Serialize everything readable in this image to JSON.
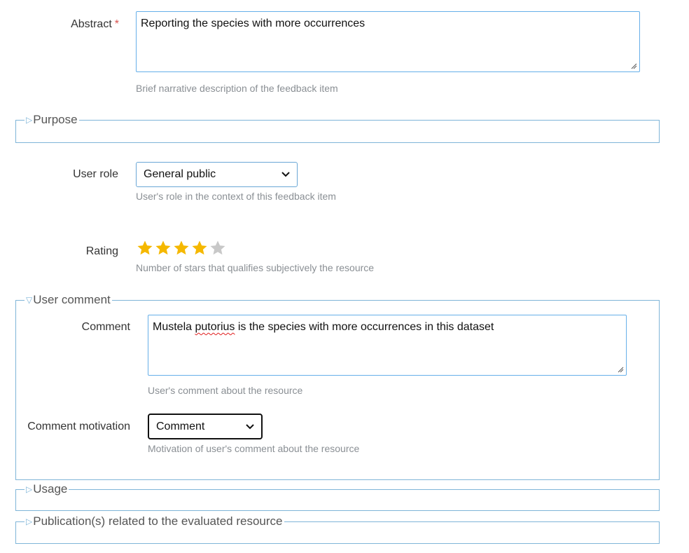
{
  "abstract": {
    "label": "Abstract",
    "required_mark": "*",
    "value": "Reporting the species with more occurrences",
    "help": "Brief narrative description of the feedback item"
  },
  "purpose": {
    "legend": "Purpose",
    "expanded": false
  },
  "user_role": {
    "label": "User role",
    "selected": "General public",
    "help": "User's role in the context of this feedback item"
  },
  "rating": {
    "label": "Rating",
    "value": 4,
    "max": 5,
    "help": "Number of stars that qualifies subjectively the resource",
    "star_color": "#f5b800",
    "empty_color": "#c8c8c8"
  },
  "user_comment": {
    "legend": "User comment",
    "expanded": true,
    "comment": {
      "label": "Comment",
      "value_pre": "Mustela ",
      "value_misspelled": "putorius",
      "value_post": " is the species with more occurrences in this dataset",
      "help": "User's comment about the resource"
    },
    "motivation": {
      "label": "Comment motivation",
      "selected": "Comment",
      "help": "Motivation of user's comment about the resource"
    }
  },
  "usage": {
    "legend": "Usage",
    "expanded": false
  },
  "publications": {
    "legend": "Publication(s) related to the evaluated resource",
    "expanded": false
  },
  "icons": {
    "collapsed": "triangle-right-icon",
    "expanded": "triangle-down-icon",
    "dropdown": "chevron-down-icon",
    "resize": "resize-grip-icon",
    "star": "star-icon"
  },
  "colors": {
    "border_accent": "#7fb5d8",
    "help_text": "#8a8f94",
    "required": "#d9534f"
  }
}
